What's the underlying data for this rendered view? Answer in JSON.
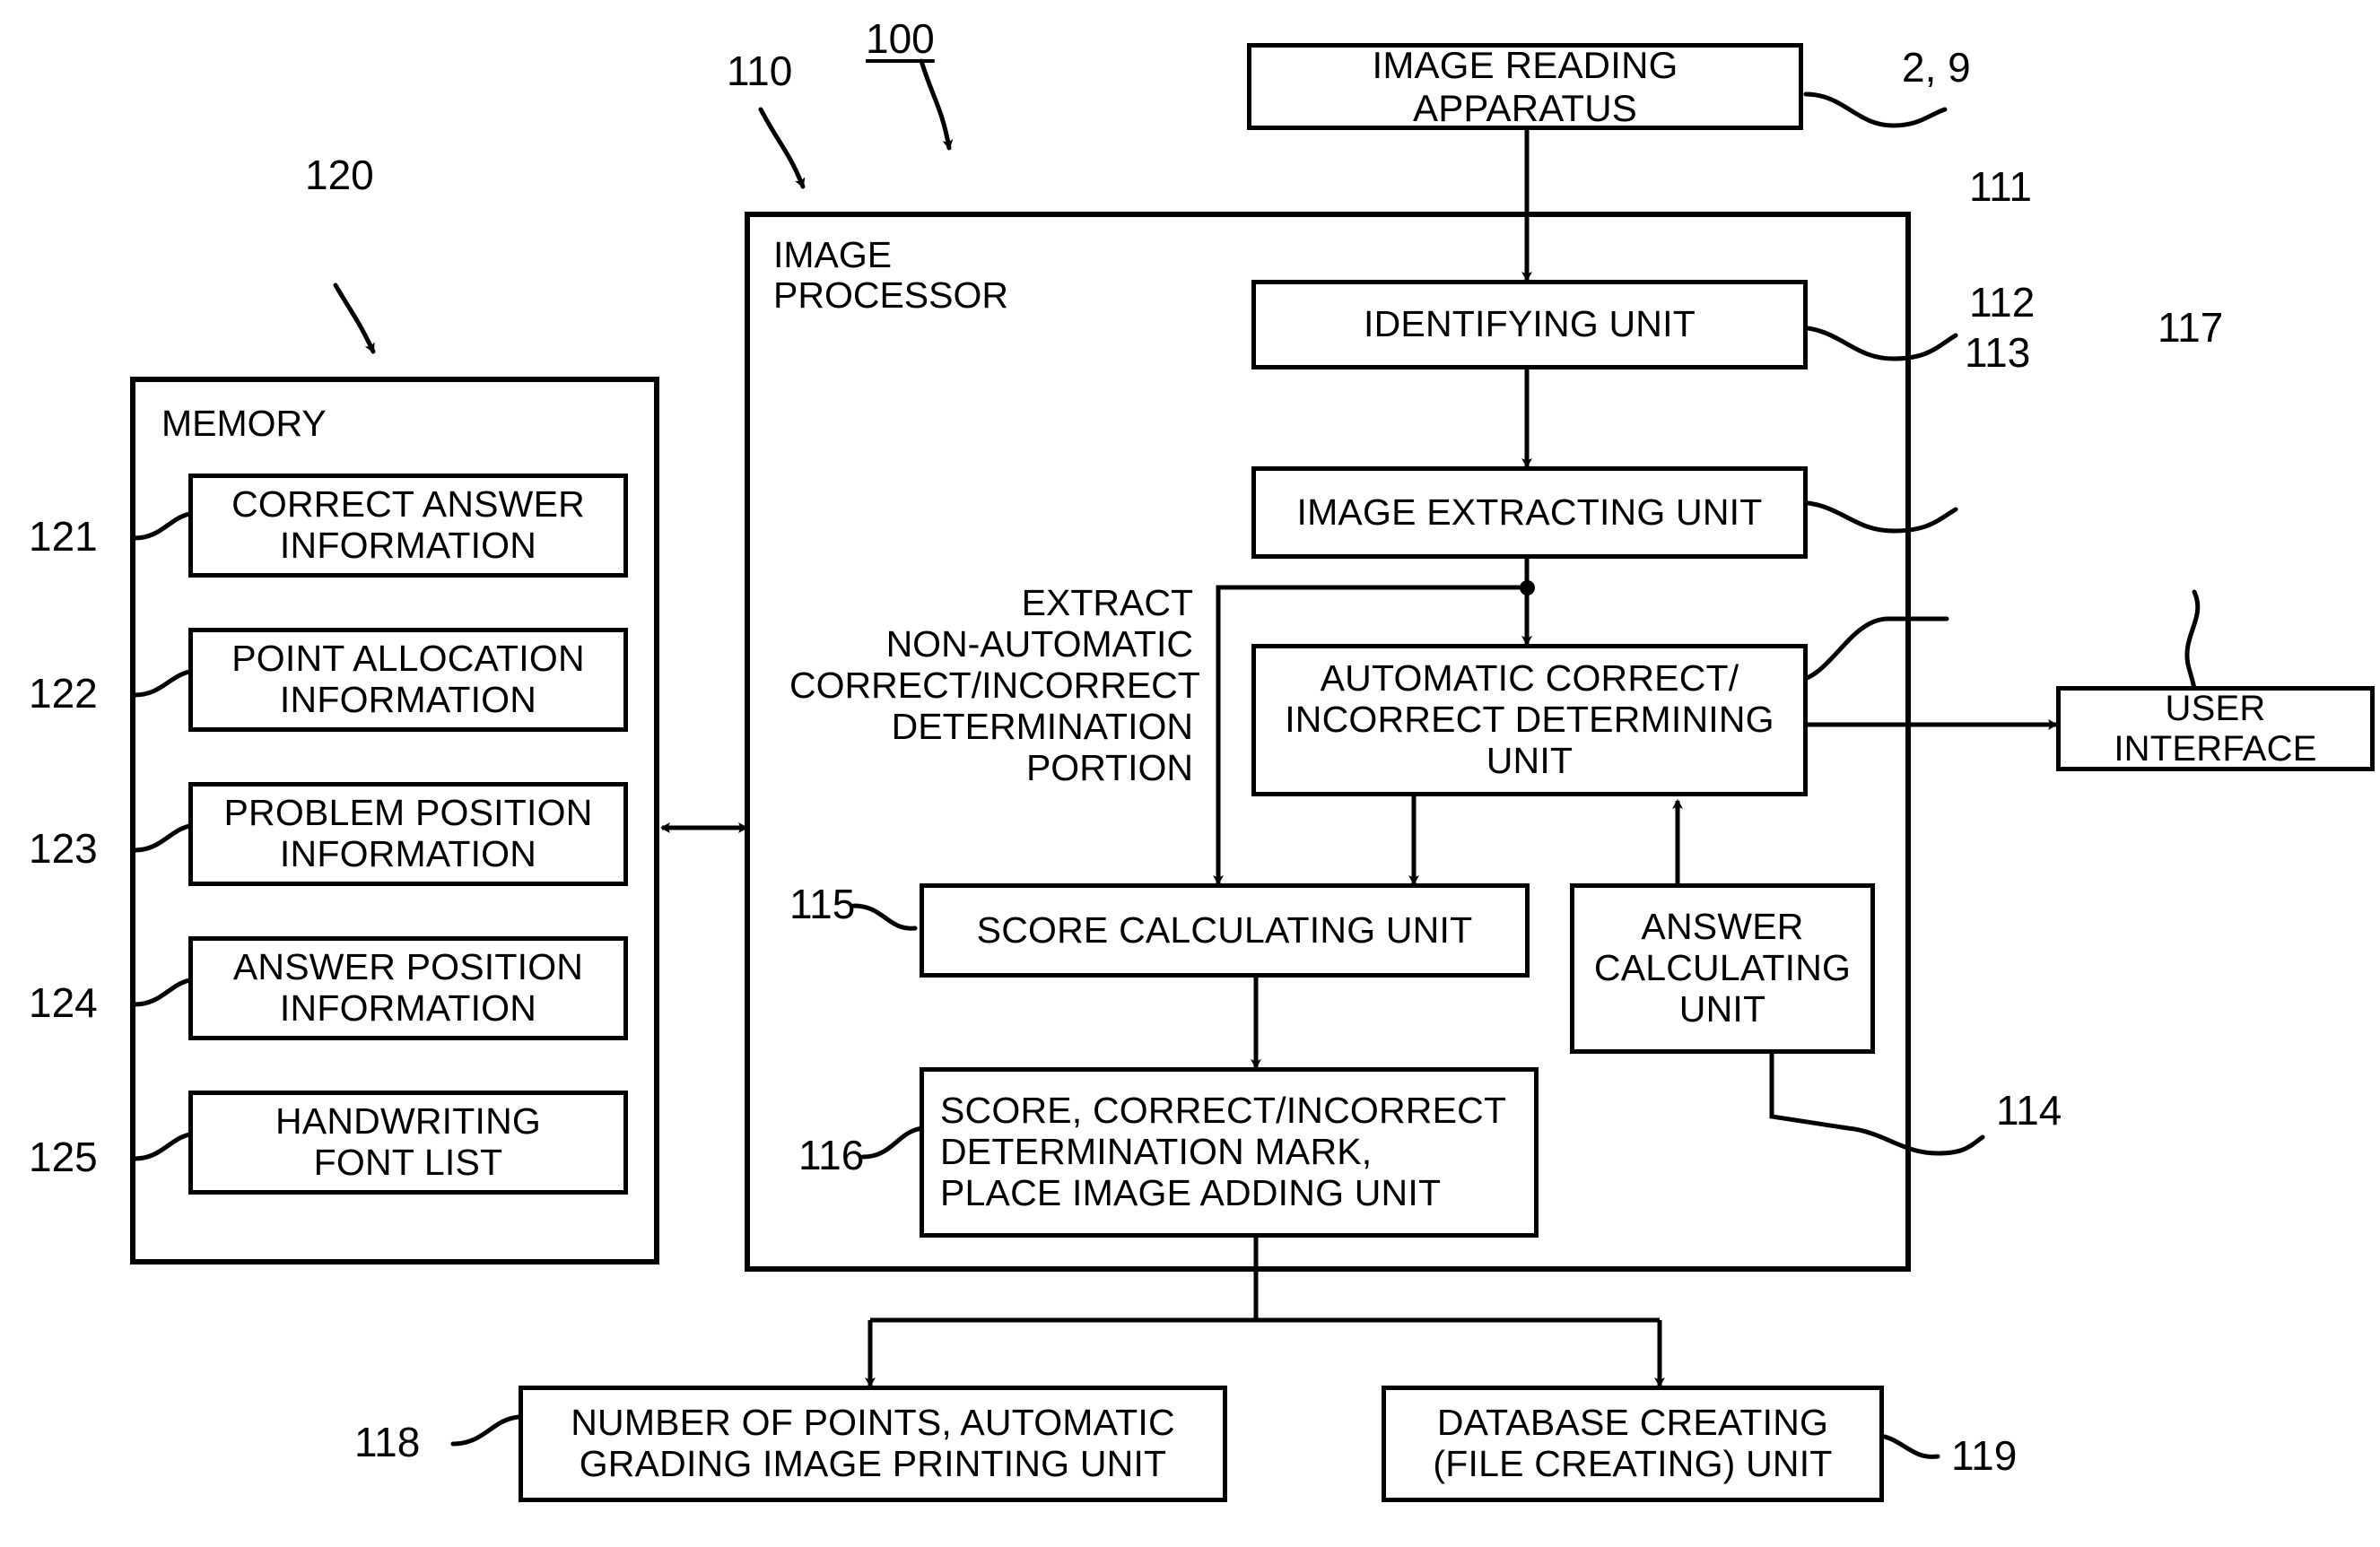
{
  "figure": {
    "system_ref": "100",
    "image_processor_ref": "110",
    "memory_ref": "120",
    "reading_apparatus_ref": "2, 9",
    "user_interface_ref": "117"
  },
  "image_reading_apparatus": {
    "label": "IMAGE READING\nAPPARATUS",
    "ref": "2, 9"
  },
  "image_processor": {
    "title": "IMAGE\nPROCESSOR",
    "ref": "110",
    "units": [
      {
        "ref": "111",
        "label": "IDENTIFYING UNIT"
      },
      {
        "ref": "112",
        "label": "IMAGE EXTRACTING UNIT"
      },
      {
        "ref": "113",
        "label": "AUTOMATIC CORRECT/\nINCORRECT DETERMINING\nUNIT"
      },
      {
        "ref": "114",
        "label": "ANSWER\nCALCULATING\nUNIT"
      },
      {
        "ref": "115",
        "label": "SCORE CALCULATING UNIT"
      },
      {
        "ref": "116",
        "label": "SCORE, CORRECT/INCORRECT\nDETERMINATION MARK,\nPLACE IMAGE ADDING UNIT"
      }
    ],
    "annotation": "EXTRACT\nNON-AUTOMATIC\nCORRECT/INCORRECT\nDETERMINATION\nPORTION"
  },
  "memory": {
    "title": "MEMORY",
    "ref": "120",
    "items": [
      {
        "ref": "121",
        "label": "CORRECT ANSWER\nINFORMATION"
      },
      {
        "ref": "122",
        "label": "POINT ALLOCATION\nINFORMATION"
      },
      {
        "ref": "123",
        "label": "PROBLEM POSITION\nINFORMATION"
      },
      {
        "ref": "124",
        "label": "ANSWER POSITION\nINFORMATION"
      },
      {
        "ref": "125",
        "label": "HANDWRITING\nFONT LIST"
      }
    ]
  },
  "user_interface": {
    "label": "USER INTERFACE",
    "ref": "117"
  },
  "outputs": [
    {
      "ref": "118",
      "label": "NUMBER OF POINTS, AUTOMATIC\nGRADING IMAGE PRINTING UNIT"
    },
    {
      "ref": "119",
      "label": "DATABASE CREATING\n(FILE CREATING) UNIT"
    }
  ],
  "colors": {
    "stroke": "#000000",
    "background": "#ffffff"
  }
}
